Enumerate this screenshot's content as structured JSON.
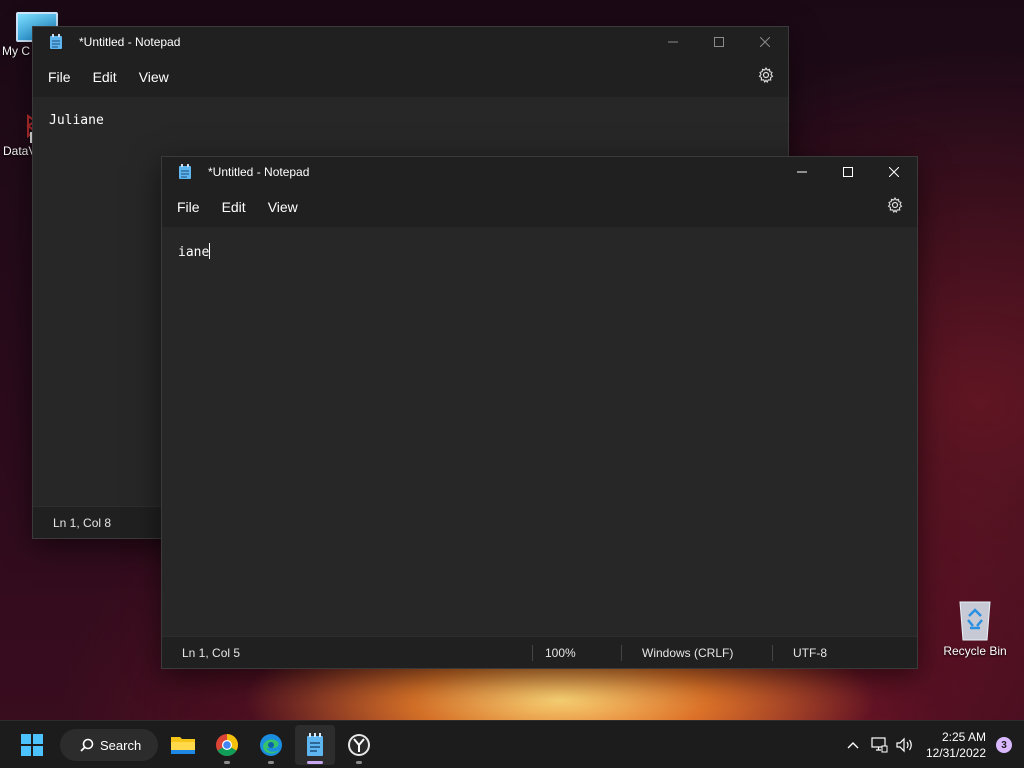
{
  "desktop": {
    "icons": [
      {
        "label": "My C",
        "name": "my-computer"
      },
      {
        "label": "DataV",
        "name": "datav"
      },
      {
        "label": "Recycle Bin",
        "name": "recycle-bin"
      }
    ]
  },
  "windows": [
    {
      "title": "*Untitled - Notepad",
      "menus": [
        "File",
        "Edit",
        "View"
      ],
      "content": "Juliane",
      "status": {
        "position": "Ln 1, Col 8"
      },
      "state": "inactive"
    },
    {
      "title": "*Untitled - Notepad",
      "menus": [
        "File",
        "Edit",
        "View"
      ],
      "content": "iane",
      "status": {
        "position": "Ln 1, Col 5",
        "zoom": "100%",
        "line_ending": "Windows (CRLF)",
        "encoding": "UTF-8"
      },
      "state": "active"
    }
  ],
  "taskbar": {
    "search_label": "Search",
    "apps": [
      "start",
      "search",
      "file-explorer",
      "chrome",
      "edge",
      "notepad",
      "clock-app"
    ],
    "time": "2:25 AM",
    "date": "12/31/2022",
    "notification_count": "3"
  },
  "colors": {
    "accent": "#c7a8f0",
    "window_bg": "#202020",
    "editor_bg": "#272727",
    "taskbar_bg": "#1c1c1c"
  }
}
